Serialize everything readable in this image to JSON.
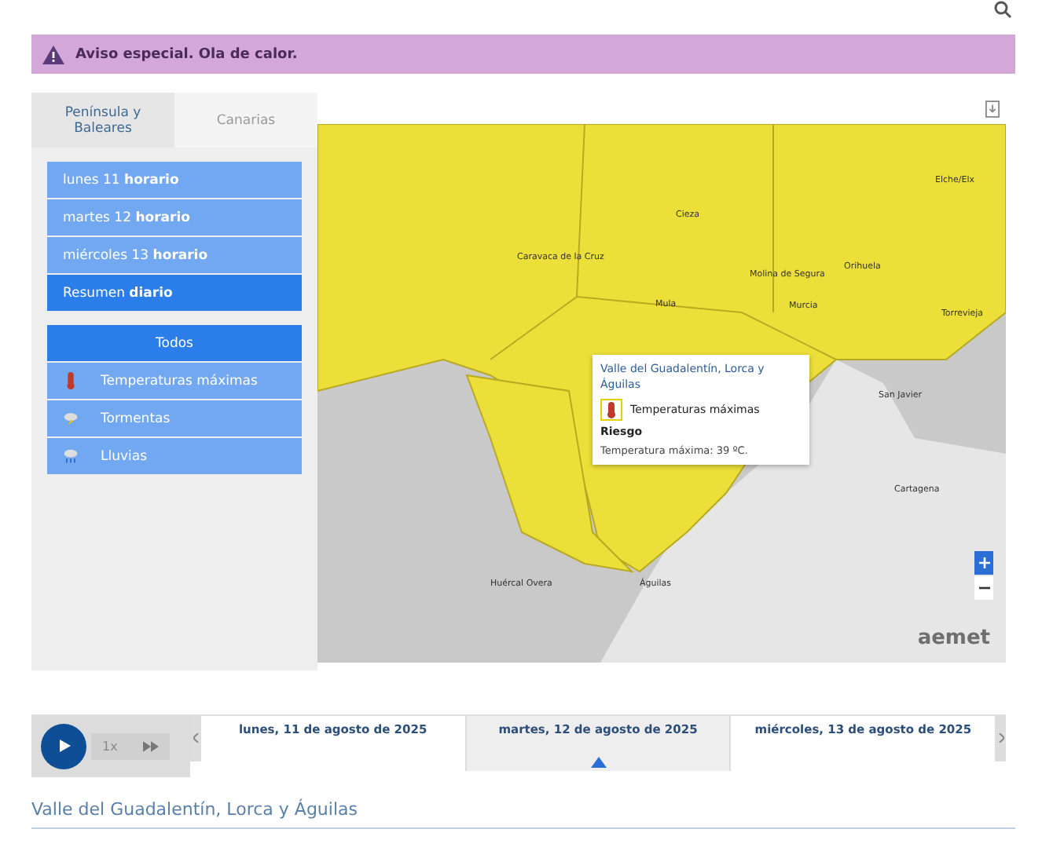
{
  "banner": {
    "text": "Aviso especial. Ola de calor."
  },
  "region_tabs": [
    {
      "label": "Península y Baleares",
      "selected": true
    },
    {
      "label": "Canarias",
      "selected": false
    }
  ],
  "periods": [
    {
      "label": "lunes 11 **horario**",
      "selected": false
    },
    {
      "label": "martes 12 **horario**",
      "selected": false
    },
    {
      "label": "miércoles 13 **horario**",
      "selected": false
    },
    {
      "label": "Resumen **diario**",
      "selected": true
    }
  ],
  "filters": [
    {
      "label": "Todos",
      "kind": "all",
      "selected": true
    },
    {
      "label": "Temperaturas máximas",
      "kind": "heat",
      "selected": false
    },
    {
      "label": "Tormentas",
      "kind": "storm",
      "selected": false
    },
    {
      "label": "Lluvias",
      "kind": "rain",
      "selected": false
    }
  ],
  "map": {
    "places": [
      "Cieza",
      "Caravaca de la Cruz",
      "Mula",
      "Molina de Segura",
      "Murcia",
      "Orihuela",
      "Elche/Elx",
      "Torrevieja",
      "San Javier",
      "Cartagena",
      "Huércal Overa",
      "Águilas"
    ],
    "popup": {
      "title": "Valle del Guadalentín, Lorca y Águilas",
      "warning": "Temperaturas máximas",
      "level": "Riesgo",
      "detail": "Temperatura máxima: 39 ºC."
    },
    "brand": "aemet"
  },
  "player": {
    "speed": "1x"
  },
  "days": [
    {
      "label": "lunes, 11 de agosto de 2025",
      "selected": false
    },
    {
      "label": "martes, 12 de agosto de 2025",
      "selected": true
    },
    {
      "label": "miércoles, 13 de agosto de 2025",
      "selected": false
    }
  ],
  "zone_heading": "Valle del Guadalentín, Lorca y Águilas"
}
